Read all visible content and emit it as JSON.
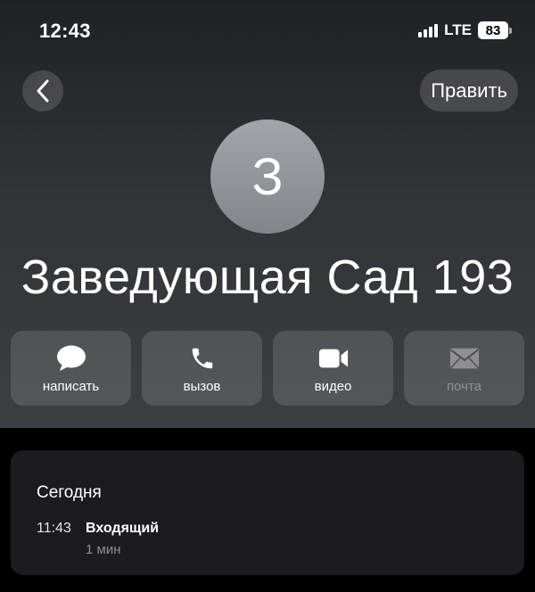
{
  "status_bar": {
    "time": "12:43",
    "network": "LTE",
    "battery": "83"
  },
  "nav": {
    "edit_label": "Править"
  },
  "contact": {
    "initial": "З",
    "name": "Заведующая Сад 193"
  },
  "actions": [
    {
      "label": "написать",
      "icon": "message-icon",
      "enabled": true
    },
    {
      "label": "вызов",
      "icon": "phone-icon",
      "enabled": true
    },
    {
      "label": "видео",
      "icon": "video-icon",
      "enabled": true
    },
    {
      "label": "почта",
      "icon": "mail-icon",
      "enabled": false
    }
  ],
  "history": {
    "title": "Сегодня",
    "entries": [
      {
        "time": "11:43",
        "type": "Входящий",
        "duration": "1 мин"
      }
    ]
  }
}
